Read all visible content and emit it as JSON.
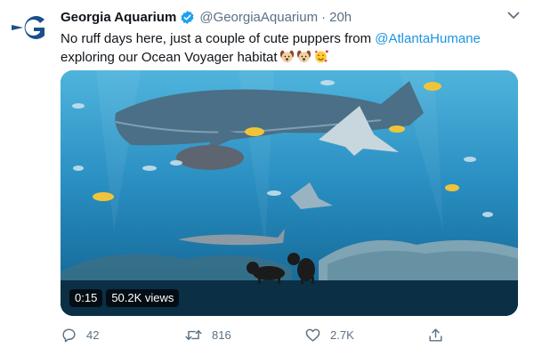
{
  "author": {
    "name": "Georgia Aquarium",
    "handle": "@GeorgiaAquarium",
    "separator": "·",
    "time": "20h",
    "avatar_icon": "georgia-aquarium-logo-icon",
    "verified_icon": "verified-badge-icon",
    "brand_color": "#1a4f8b",
    "verified_color": "#1da1f2"
  },
  "tweet": {
    "text_part1": "No ruff days here, just a couple of cute puppers from ",
    "mention": "@AtlantaHumane",
    "text_part2": " exploring our Ocean Voyager habitat",
    "emojis": [
      "dog-face-icon",
      "dog-face-icon",
      "smiling-face-with-hearts-icon"
    ],
    "mention_color": "#1b95e0"
  },
  "video": {
    "time": "0:15",
    "views": "50.2K views"
  },
  "actions": {
    "reply_count": "42",
    "retweet_count": "816",
    "like_count": "2.7K",
    "reply_icon": "reply-icon",
    "retweet_icon": "retweet-icon",
    "like_icon": "heart-icon",
    "share_icon": "share-icon",
    "icon_color": "#5b7083"
  },
  "menu": {
    "icon": "chevron-down-icon"
  }
}
